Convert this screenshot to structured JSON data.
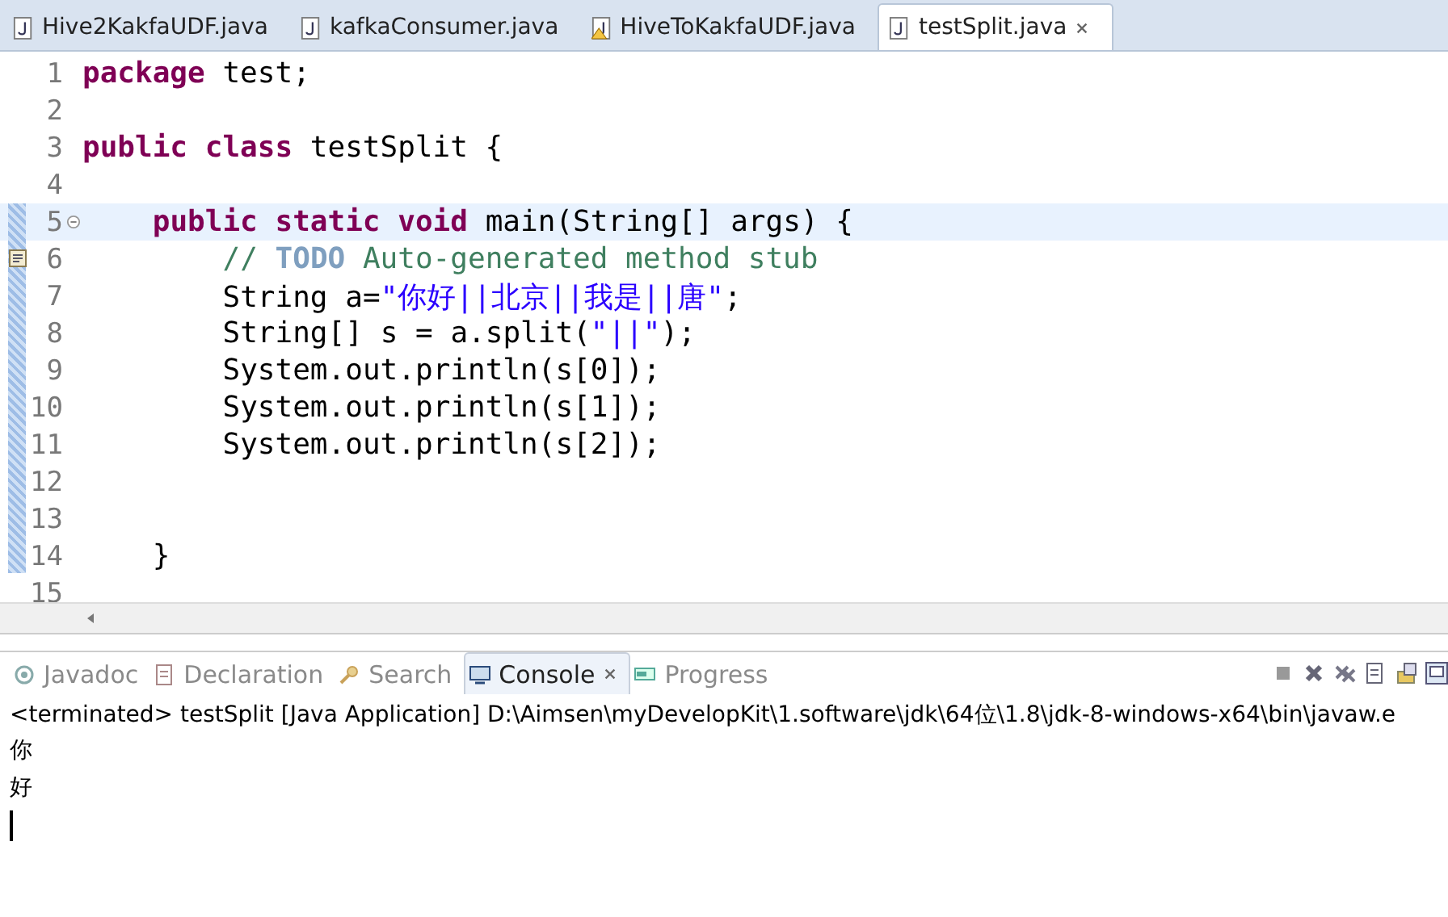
{
  "editor_tabs": [
    {
      "label": "Hive2KakfaUDF.java",
      "selected": false,
      "warning": false
    },
    {
      "label": "kafkaConsumer.java",
      "selected": false,
      "warning": false
    },
    {
      "label": "HiveToKakfaUDF.java",
      "selected": false,
      "warning": true
    },
    {
      "label": "testSplit.java",
      "selected": true,
      "warning": false
    }
  ],
  "code_lines": [
    {
      "number": "1",
      "current": false,
      "fold": false,
      "task": false,
      "text": "package test;"
    },
    {
      "number": "2",
      "current": false,
      "fold": false,
      "task": false
    },
    {
      "number": "3",
      "current": false,
      "fold": false,
      "task": false,
      "text": "public class testSplit {"
    },
    {
      "number": "4",
      "current": false,
      "fold": false,
      "task": false
    },
    {
      "number": "5",
      "current": true,
      "fold": true,
      "task": false,
      "text": "    public static void main(String[] args) {"
    },
    {
      "number": "6",
      "current": false,
      "fold": false,
      "task": true,
      "text": "        // TODO Auto-generated method stub"
    },
    {
      "number": "7",
      "current": false,
      "fold": false,
      "task": false,
      "text": "        String a=\"你好||北京||我是||唐\";"
    },
    {
      "number": "8",
      "current": false,
      "fold": false,
      "task": false,
      "text": "        String[] s = a.split(\"||\");"
    },
    {
      "number": "9",
      "current": false,
      "fold": false,
      "task": false,
      "text": "        System.out.println(s[0]);"
    },
    {
      "number": "10",
      "current": false,
      "fold": false,
      "task": false,
      "text": "        System.out.println(s[1]);"
    },
    {
      "number": "11",
      "current": false,
      "fold": false,
      "task": false,
      "text": "        System.out.println(s[2]);"
    },
    {
      "number": "12",
      "current": false,
      "fold": false,
      "task": false
    },
    {
      "number": "13",
      "current": false,
      "fold": false,
      "task": false
    },
    {
      "number": "14",
      "current": false,
      "fold": false,
      "task": false,
      "text": "    }"
    },
    {
      "number": "15",
      "current": false,
      "fold": false,
      "task": false
    }
  ],
  "view_tabs": [
    {
      "label": "Javadoc",
      "selected": false
    },
    {
      "label": "Declaration",
      "selected": false
    },
    {
      "label": "Search",
      "selected": false
    },
    {
      "label": "Console",
      "selected": true
    },
    {
      "label": "Progress",
      "selected": false
    }
  ],
  "console": {
    "header": "<terminated> testSplit [Java Application] D:\\Aimsen\\myDevelopKit\\1.software\\jdk\\64位\\1.8\\jdk-8-windows-x64\\bin\\javaw.e",
    "output": [
      "你",
      "好"
    ]
  }
}
